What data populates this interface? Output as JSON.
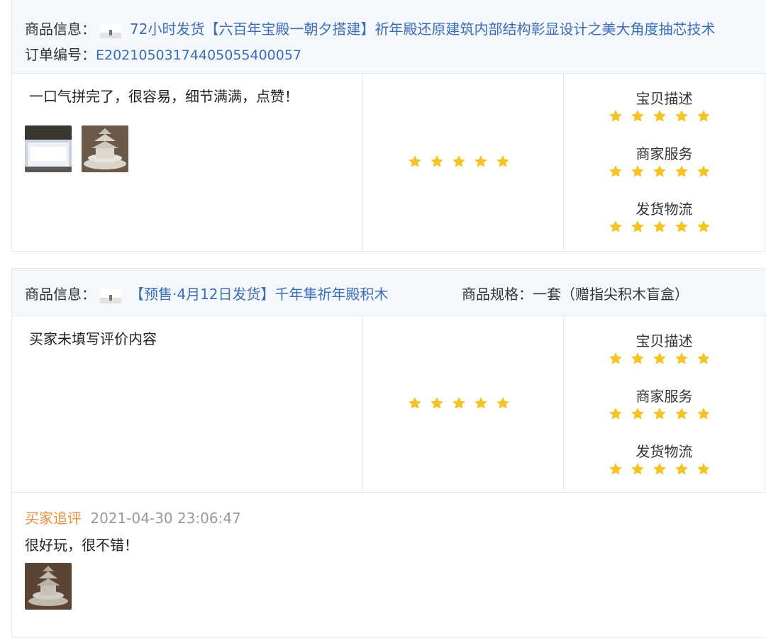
{
  "review1": {
    "product_label": "商品信息：",
    "product_title": "72小时发货【六百年宝殿一朝夕搭建】祈年殿还原建筑内部结构彰显设计之美大角度抽芯技术",
    "order_label": "订单编号：",
    "order_number": "E20210503174405055400057",
    "comment": "一口气拼完了，很容易，细节满满，点赞！",
    "overall_rating": 5,
    "ratings": [
      {
        "label": "宝贝描述",
        "stars": 5
      },
      {
        "label": "商家服务",
        "stars": 5
      },
      {
        "label": "发货物流",
        "stars": 5
      }
    ]
  },
  "review2": {
    "product_label": "商品信息：",
    "product_title": "【预售·4月12日发货】千年隼祈年殿积木",
    "spec_label": "商品规格：",
    "spec_value": "一套（赠指尖积木盲盒）",
    "comment": "买家未填写评价内容",
    "overall_rating": 5,
    "ratings": [
      {
        "label": "宝贝描述",
        "stars": 5
      },
      {
        "label": "商家服务",
        "stars": 5
      },
      {
        "label": "发货物流",
        "stars": 5
      }
    ],
    "followup": {
      "label": "买家追评",
      "timestamp": "2021-04-30 23:06:47",
      "text": "很好玩，很不错！"
    }
  },
  "colors": {
    "star": "#f5c323",
    "link": "#3a6eb6",
    "followup_label": "#e8913a"
  },
  "icons": {
    "star": "star-icon"
  }
}
